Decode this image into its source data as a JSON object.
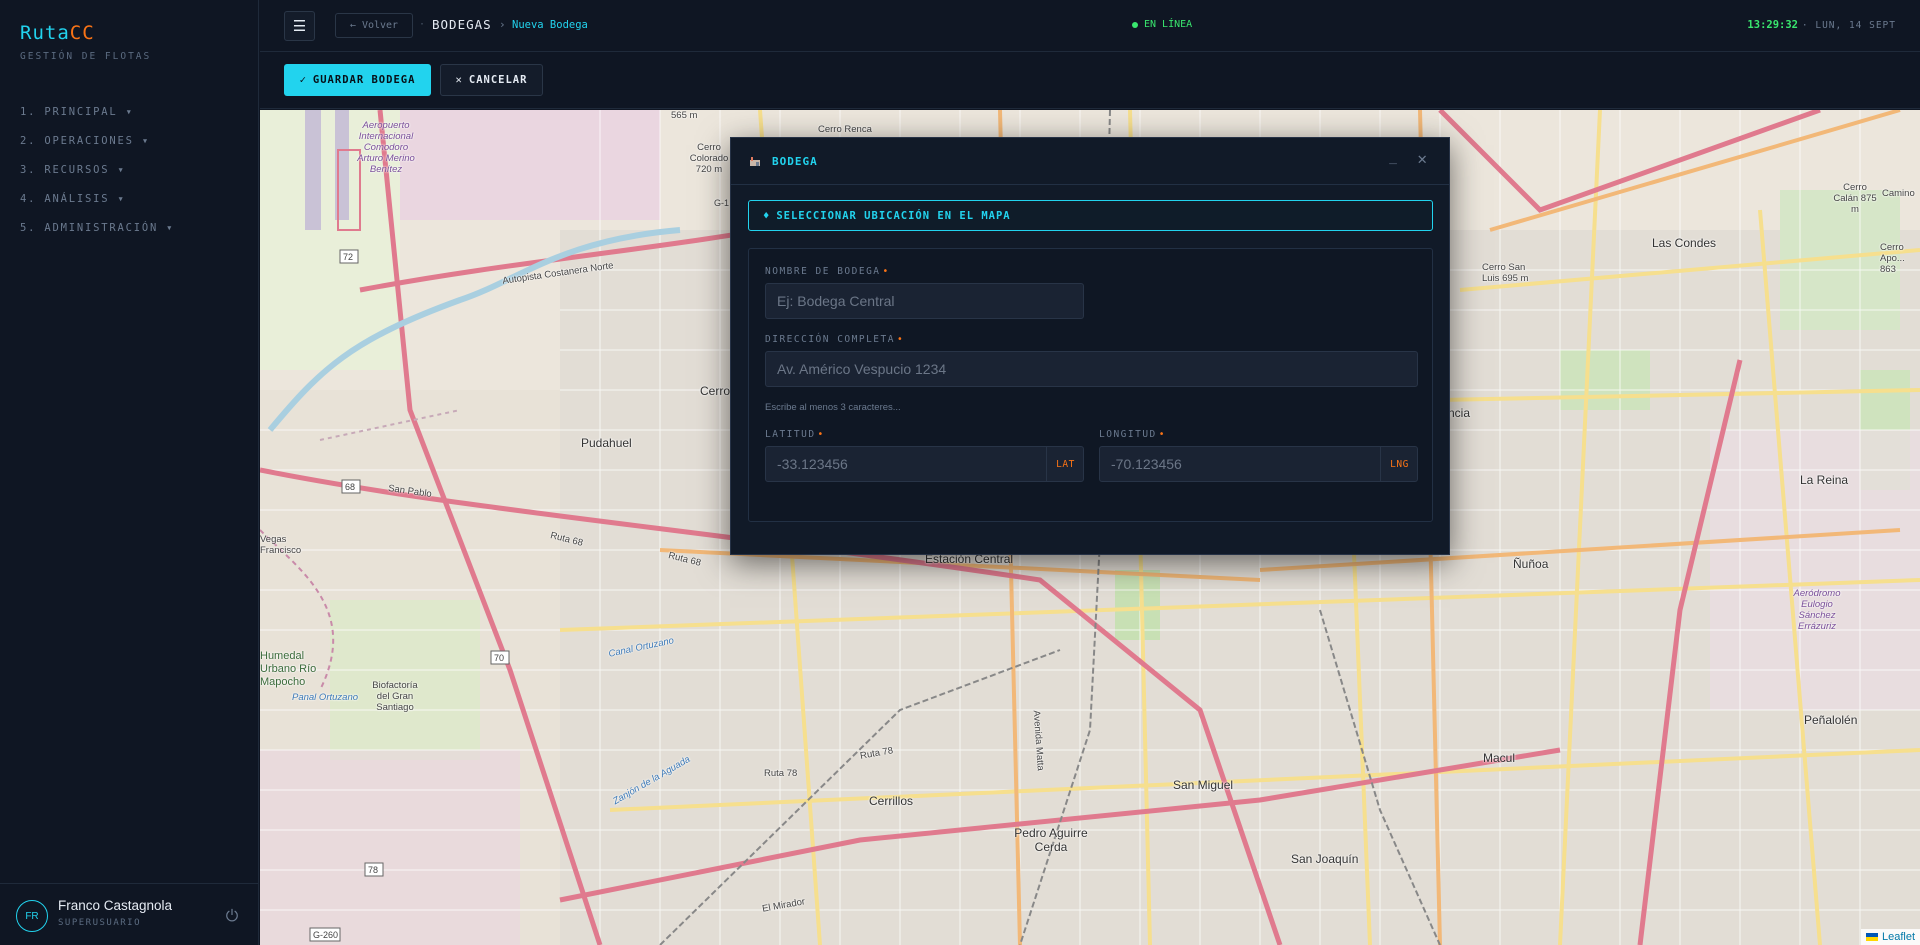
{
  "brand": {
    "part1": "Ruta",
    "part2": "CC",
    "subtitle": "GESTIÓN DE FLOTAS"
  },
  "nav": [
    {
      "label": "1. PRINCIPAL ▾"
    },
    {
      "label": "2. OPERACIONES ▾"
    },
    {
      "label": "3. RECURSOS ▾"
    },
    {
      "label": "4. ANÁLISIS ▾"
    },
    {
      "label": "5. ADMINISTRACIÓN ▾"
    }
  ],
  "user": {
    "initials": "FR",
    "name": "Franco Castagnola",
    "role": "SUPERUSUARIO"
  },
  "topbar": {
    "back_label": "← Volver",
    "crumb_dot": "·",
    "crumb_main": "BODEGAS",
    "crumb_sep": "›",
    "crumb_sub": "Nueva Bodega",
    "status": "EN LÍNEA",
    "clock": "13:29:32",
    "date": "· LUN, 14 SEPT"
  },
  "actions": {
    "save_label": "GUARDAR BODEGA",
    "save_glyph": "✓",
    "cancel_label": "CANCELAR",
    "cancel_glyph": "✕"
  },
  "modal": {
    "title": "BODEGA",
    "min_glyph": "_",
    "close_glyph": "✕",
    "pick_glyph": "♦",
    "pick_label": "SELECCIONAR UBICACIÓN EN EL MAPA",
    "name_label": "NOMBRE DE BODEGA",
    "name_placeholder": "Ej: Bodega Central",
    "address_label": "DIRECCIÓN COMPLETA",
    "address_placeholder": "Av. Américo Vespucio 1234",
    "address_hint": "Escribe al menos 3 caracteres...",
    "lat_label": "LATITUD",
    "lat_placeholder": "-33.123456",
    "lat_unit": "LAT",
    "lng_label": "LONGITUD",
    "lng_placeholder": "-70.123456",
    "lng_unit": "LNG",
    "required_mark": "•"
  },
  "map": {
    "attribution": "Leaflet",
    "labels": {
      "airport": "Aeropuerto Internacional Comodoro Arturo Merino Benítez",
      "pudahuel": "Pudahuel",
      "estacion_central": "Estación Central",
      "cerrillos": "Cerrillos",
      "pedro_aguirre_cerda": "Pedro Aguirre Cerda",
      "san_miguel": "San Miguel",
      "san_joaquin": "San Joaquín",
      "macul": "Macul",
      "nunoa": "Ñuñoa",
      "la_reina": "La Reina",
      "penalolen": "Peñalolén",
      "las_condes": "Las Condes",
      "cerro_san_luis": "Cerro San Luis 695 m",
      "cerro_colorado": "Cerro Colorado 720 m",
      "cerro_renca": "Cerro Renca",
      "elev_565": "565 m",
      "cerro_calan": "Cerro Calán 875 m",
      "camino": "Camino",
      "cerro_apoq": "Cerro Apo... 863",
      "aerodromo": "Aeródromo Eulogio Sánchez Errázuriz",
      "humedal": "Humedal Urbano Río Mapocho",
      "biofactoria": "Biofactoría del Gran Santiago",
      "canal_ortuzano": "Canal Ortuzano",
      "panal_ortuzano": "Panal Ortuzano",
      "ruta68": "Ruta 68",
      "ruta78": "Ruta 78",
      "ruta78b": "Ruta 78",
      "ruta68b": "Ruta 68",
      "autopista": "Autopista Costanera Norte",
      "el_mirador": "El Mirador",
      "san_pablo": "San Pablo",
      "vegas": "Vegas Francisco",
      "cerro_short": "Cerro",
      "ncia": "ncia",
      "av_matta": "Avenida Matta",
      "zanjon": "Zanjón de la Aguada",
      "shield_68": "68",
      "shield_70": "70",
      "shield_72": "72",
      "shield_78": "78",
      "shield_g260": "G-260",
      "shield_g1": "G-1"
    }
  }
}
